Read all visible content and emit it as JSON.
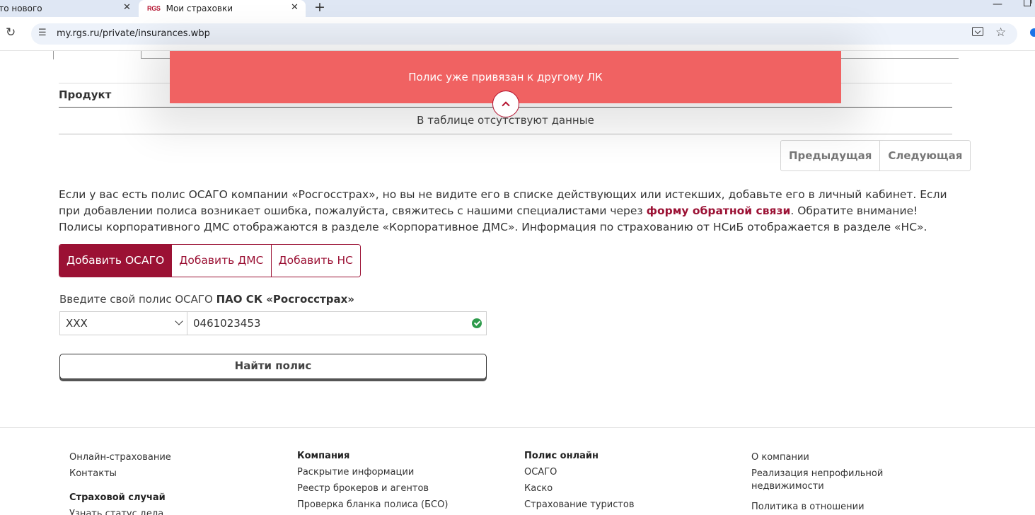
{
  "browser": {
    "tabs": [
      {
        "title": "Что нового",
        "active": false
      },
      {
        "title": "Мои страховки",
        "active": true,
        "favicon": "RGS"
      }
    ],
    "url": "my.rgs.ru/private/insurances.wbp"
  },
  "toast": {
    "message": "Полис уже привязан к другому ЛК",
    "color": "#f06262"
  },
  "table": {
    "column_product": "Продукт",
    "empty_message": "В таблице отсутствуют данные",
    "pager": {
      "prev": "Предыдущая",
      "next": "Следующая"
    }
  },
  "info": {
    "text_1": "Если у вас есть полис ОСАГО компании «Росгосстрах», но вы не видите его в списке действующих или истекших, добавьте его в личный кабинет. Если при добавлении полиса возникает ошибка, пожалуйста, свяжитесь с нашими специалистами через ",
    "link": "форму обратной связи",
    "text_2": ". Обратите внимание! Полисы корпоративного ДМС отображаются в разделе «Корпоративное ДМС». Информация по страхованию от НСиБ отображается в разделе «НС»."
  },
  "add_tabs": [
    {
      "label": "Добавить ОСАГО",
      "active": true
    },
    {
      "label": "Добавить ДМС",
      "active": false
    },
    {
      "label": "Добавить НС",
      "active": false
    }
  ],
  "form": {
    "label_prefix": "Введите свой полис ОСАГО ",
    "label_company": "ПАО СК «Росгосстрах»",
    "series_value": "XXX",
    "number_value": "0461023453",
    "submit_label": "Найти полис"
  },
  "footer": {
    "col1": {
      "items": [
        "Онлайн-страхование",
        "Контакты"
      ],
      "heading2": "Страховой случай",
      "items2": [
        "Узнать статус дела"
      ]
    },
    "col2": {
      "heading": "Компания",
      "items": [
        "Раскрытие информации",
        "Реестр брокеров и агентов",
        "Проверка бланка полиса (БСО)"
      ]
    },
    "col3": {
      "heading": "Полис онлайн",
      "items": [
        "ОСАГО",
        "Каско",
        "Страхование туристов"
      ]
    },
    "col4": {
      "items": [
        "О компании",
        "Реализация непрофильной недвижимости",
        "Политика в отношении обработки"
      ]
    }
  },
  "colors": {
    "brand": "#9b1134",
    "success": "#2e9b4c"
  }
}
